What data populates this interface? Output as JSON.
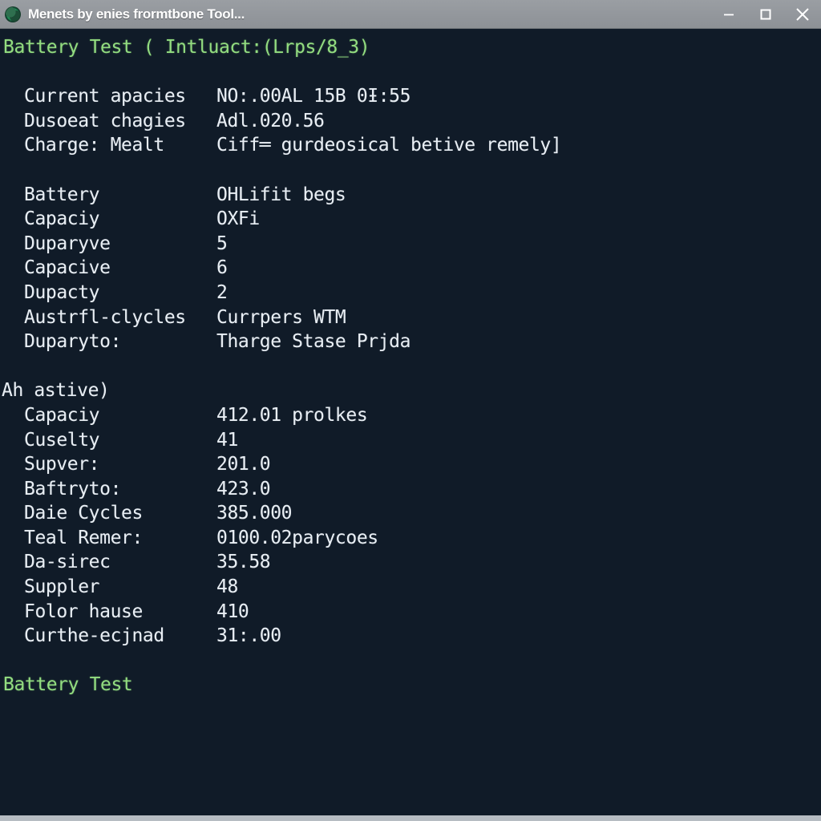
{
  "window": {
    "title": "Menets by enies frormtbone Tool...",
    "icon": "app-globe-icon",
    "titlebar_bg": "#93979c",
    "controls": {
      "minimize": "minimize-icon",
      "maximize": "maximize-icon",
      "close": "close-icon"
    }
  },
  "console": {
    "background": "#101b28",
    "text_color": "#e8eef4",
    "accent_color": "#93dd80",
    "header": "Battery Test ( Intluact:(Lrps/8_3)",
    "footer": "Battery Test",
    "section_header_3": "Aһ astive)",
    "block1": [
      {
        "label": "Current apacies",
        "value": "NO:.00AL 15B 0Ɨ:55"
      },
      {
        "label": "Dusoeat chagies",
        "value": "Adl.020.56"
      },
      {
        "label": "Charge: Mealt",
        "value": "Ciff═ gurdeosical betive remely]"
      }
    ],
    "block2": [
      {
        "label": "Battery",
        "value": "OHLifit begs"
      },
      {
        "label": "Capaciy",
        "value": "OXFi"
      },
      {
        "label": "Duparyve",
        "value": "5"
      },
      {
        "label": "Capacive",
        "value": "6"
      },
      {
        "label": "Dupacty",
        "value": "2"
      },
      {
        "label": "Austrfl-clycles",
        "value": "Currpers WTM"
      },
      {
        "label": "Duparyto:",
        "value": "Tharge Stase Prjda"
      }
    ],
    "block3": [
      {
        "label": "Capaciy",
        "value": "412.01 prolkes"
      },
      {
        "label": "Cuselty",
        "value": "41"
      },
      {
        "label": "Supver:",
        "value": "201.0"
      },
      {
        "label": "Baftryto:",
        "value": "423.0"
      },
      {
        "label": "Daie Cycles",
        "value": "385.000"
      },
      {
        "label": "Teal Remer:",
        "value": "0100.02parycoes"
      },
      {
        "label": "Da-sirec",
        "value": "35.58"
      },
      {
        "label": "Suppler",
        "value": "48"
      },
      {
        "label": "Folor hause",
        "value": "410"
      },
      {
        "label": "Curthe-ecjnad",
        "value": "31:.00"
      }
    ]
  }
}
